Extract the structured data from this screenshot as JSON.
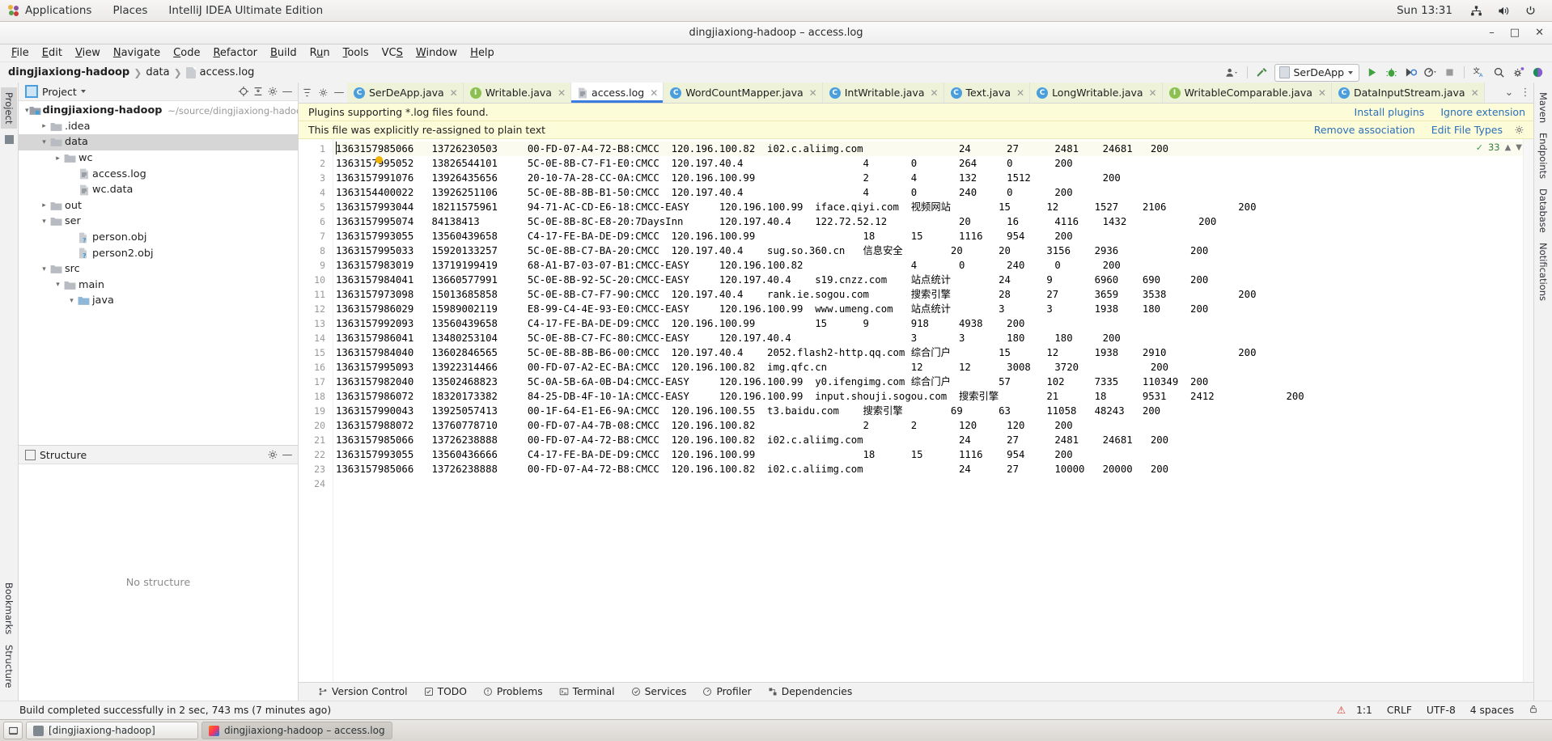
{
  "desktop": {
    "logo_icon": "gnome-logo-icon",
    "menus": [
      "Applications",
      "Places"
    ],
    "app_name": "IntelliJ IDEA Ultimate Edition",
    "clock": "Sun 13:31",
    "tray": [
      "network-icon",
      "volume-icon",
      "power-icon"
    ]
  },
  "window": {
    "title": "dingjiaxiong-hadoop – access.log",
    "minimize": "–",
    "maximize": "□",
    "close": "✕"
  },
  "menubar": [
    {
      "label": "File",
      "mnemonic": "F"
    },
    {
      "label": "Edit",
      "mnemonic": "E"
    },
    {
      "label": "View",
      "mnemonic": "V"
    },
    {
      "label": "Navigate",
      "mnemonic": "N"
    },
    {
      "label": "Code",
      "mnemonic": "C"
    },
    {
      "label": "Refactor",
      "mnemonic": "R"
    },
    {
      "label": "Build",
      "mnemonic": "B"
    },
    {
      "label": "Run",
      "mnemonic": "u"
    },
    {
      "label": "Tools",
      "mnemonic": "T"
    },
    {
      "label": "VCS",
      "mnemonic": "S"
    },
    {
      "label": "Window",
      "mnemonic": "W"
    },
    {
      "label": "Help",
      "mnemonic": "H"
    }
  ],
  "navbar": {
    "breadcrumbs": [
      "dingjiaxiong-hadoop",
      "data",
      "access.log"
    ],
    "run_config": "SerDeApp",
    "icons": [
      "user-dropdown-icon",
      "build-hammer-icon",
      "run-icon",
      "debug-icon",
      "run-coverage-icon",
      "profile-icon",
      "stop-icon",
      "translate-icon",
      "search-everywhere-icon",
      "settings-gear-icon",
      "ai-assistant-icon"
    ]
  },
  "left_strip": {
    "tabs": [
      "Project",
      "Bookmarks",
      "Structure"
    ],
    "active": "Project"
  },
  "right_strip": {
    "tabs": [
      "Maven",
      "Endpoints",
      "Database",
      "Notifications"
    ]
  },
  "project_panel": {
    "title": "Project",
    "icons": [
      "locate-icon",
      "collapse-all-icon",
      "settings-gear-icon",
      "hide-icon"
    ],
    "tree": [
      {
        "label": "dingjiaxiong-hadoop",
        "path": "~/source/dingjiaxiong-hadoop",
        "depth": 0,
        "twisty": "expanded",
        "icon": "project-module-icon",
        "bold": true,
        "selected": false
      },
      {
        "label": ".idea",
        "path": "",
        "depth": 1,
        "twisty": "collapsed",
        "icon": "folder-icon",
        "bold": false,
        "selected": false
      },
      {
        "label": "data",
        "path": "",
        "depth": 1,
        "twisty": "expanded",
        "icon": "folder-icon",
        "bold": false,
        "selected": true
      },
      {
        "label": "wc",
        "path": "",
        "depth": 2,
        "twisty": "collapsed",
        "icon": "folder-icon",
        "bold": false,
        "selected": false
      },
      {
        "label": "access.log",
        "path": "",
        "depth": 3,
        "twisty": "none",
        "icon": "text-file-icon",
        "bold": false,
        "selected": false
      },
      {
        "label": "wc.data",
        "path": "",
        "depth": 3,
        "twisty": "none",
        "icon": "text-file-icon",
        "bold": false,
        "selected": false
      },
      {
        "label": "out",
        "path": "",
        "depth": 1,
        "twisty": "collapsed",
        "icon": "folder-icon",
        "bold": false,
        "selected": false
      },
      {
        "label": "ser",
        "path": "",
        "depth": 1,
        "twisty": "expanded",
        "icon": "folder-icon",
        "bold": false,
        "selected": false
      },
      {
        "label": "person.obj",
        "path": "",
        "depth": 3,
        "twisty": "none",
        "icon": "unknown-file-icon",
        "bold": false,
        "selected": false
      },
      {
        "label": "person2.obj",
        "path": "",
        "depth": 3,
        "twisty": "none",
        "icon": "unknown-file-icon",
        "bold": false,
        "selected": false
      },
      {
        "label": "src",
        "path": "",
        "depth": 1,
        "twisty": "expanded",
        "icon": "folder-icon",
        "bold": false,
        "selected": false
      },
      {
        "label": "main",
        "path": "",
        "depth": 2,
        "twisty": "expanded",
        "icon": "folder-icon",
        "bold": false,
        "selected": false
      },
      {
        "label": "java",
        "path": "",
        "depth": 3,
        "twisty": "expanded",
        "icon": "source-folder-icon",
        "bold": false,
        "selected": false
      }
    ]
  },
  "structure_panel": {
    "title": "Structure",
    "empty_text": "No structure",
    "icons": [
      "settings-gear-icon",
      "hide-icon"
    ]
  },
  "editor_tabs": [
    {
      "label": "SerDeApp.java",
      "icon": "java-class-icon",
      "active": false,
      "closable": true
    },
    {
      "label": "Writable.java",
      "icon": "java-interface-icon",
      "active": false,
      "closable": true
    },
    {
      "label": "access.log",
      "icon": "text-file-icon",
      "active": true,
      "closable": true
    },
    {
      "label": "WordCountMapper.java",
      "icon": "java-class-icon",
      "active": false,
      "closable": true
    },
    {
      "label": "IntWritable.java",
      "icon": "java-class-icon",
      "active": false,
      "closable": true
    },
    {
      "label": "Text.java",
      "icon": "java-class-icon",
      "active": false,
      "closable": true
    },
    {
      "label": "LongWritable.java",
      "icon": "java-class-icon",
      "active": false,
      "closable": true
    },
    {
      "label": "WritableComparable.java",
      "icon": "java-interface-icon",
      "active": false,
      "closable": true
    },
    {
      "label": "DataInputStream.java",
      "icon": "java-class-icon",
      "active": false,
      "closable": true
    }
  ],
  "banners": [
    {
      "text": "Plugins supporting *.log files found.",
      "links": [
        "Install plugins",
        "Ignore extension"
      ],
      "gear": false
    },
    {
      "text": "This file was explicitly re-assigned to plain text",
      "links": [
        "Remove association",
        "Edit File Types"
      ],
      "gear": true
    }
  ],
  "editor": {
    "inspection_count": "33",
    "lines": [
      "1363157985066\t13726230503\t00-FD-07-A4-72-B8:CMCC\t120.196.100.82\ti02.c.aliimg.com\t\t24\t27\t2481\t24681\t200",
      "1363157995052\t13826544101\t5C-0E-8B-C7-F1-E0:CMCC\t120.197.40.4\t\t\t4\t0\t264\t0\t200",
      "1363157991076\t13926435656\t20-10-7A-28-CC-0A:CMCC\t120.196.100.99\t\t\t2\t4\t132\t1512\t\t200",
      "1363154400022\t13926251106\t5C-0E-8B-8B-B1-50:CMCC\t120.197.40.4\t\t\t4\t0\t240\t0\t200",
      "1363157993044\t18211575961\t94-71-AC-CD-E6-18:CMCC-EASY\t120.196.100.99\tiface.qiyi.com\t视频网站\t15\t12\t1527\t2106\t\t200",
      "1363157995074\t84138413\t5C-0E-8B-8C-E8-20:7DaysInn\t120.197.40.4\t122.72.52.12\t\t20\t16\t4116\t1432\t\t200",
      "1363157993055\t13560439658\tC4-17-FE-BA-DE-D9:CMCC\t120.196.100.99\t\t\t18\t15\t1116\t954\t200",
      "1363157995033\t15920133257\t5C-0E-8B-C7-BA-20:CMCC\t120.197.40.4\tsug.so.360.cn\t信息安全\t20\t20\t3156\t2936\t\t200",
      "1363157983019\t13719199419\t68-A1-B7-03-07-B1:CMCC-EASY\t120.196.100.82\t\t\t4\t0\t240\t0\t200",
      "1363157984041\t13660577991\t5C-0E-8B-92-5C-20:CMCC-EASY\t120.197.40.4\ts19.cnzz.com\t站点统计\t24\t9\t6960\t690\t200",
      "1363157973098\t15013685858\t5C-0E-8B-C7-F7-90:CMCC\t120.197.40.4\trank.ie.sogou.com\t搜索引擎\t28\t27\t3659\t3538\t\t200",
      "1363157986029\t15989002119\tE8-99-C4-4E-93-E0:CMCC-EASY\t120.196.100.99\twww.umeng.com\t站点统计\t3\t3\t1938\t180\t200",
      "1363157992093\t13560439658\tC4-17-FE-BA-DE-D9:CMCC\t120.196.100.99\t\t15\t9\t918\t4938\t200",
      "1363157986041\t13480253104\t5C-0E-8B-C7-FC-80:CMCC-EASY\t120.197.40.4\t\t\t3\t3\t180\t180\t200",
      "1363157984040\t13602846565\t5C-0E-8B-8B-B6-00:CMCC\t120.197.40.4\t2052.flash2-http.qq.com\t综合门户\t15\t12\t1938\t2910\t\t200",
      "1363157995093\t13922314466\t00-FD-07-A2-EC-BA:CMCC\t120.196.100.82\timg.qfc.cn\t\t12\t12\t3008\t3720\t\t200",
      "1363157982040\t13502468823\t5C-0A-5B-6A-0B-D4:CMCC-EASY\t120.196.100.99\ty0.ifengimg.com\t综合门户\t57\t102\t7335\t110349\t200",
      "1363157986072\t18320173382\t84-25-DB-4F-10-1A:CMCC-EASY\t120.196.100.99\tinput.shouji.sogou.com\t搜索引擎\t21\t18\t9531\t2412\t\t200",
      "1363157990043\t13925057413\t00-1F-64-E1-E6-9A:CMCC\t120.196.100.55\tt3.baidu.com\t搜索引擎\t69\t63\t11058\t48243\t200",
      "1363157988072\t13760778710\t00-FD-07-A4-7B-08:CMCC\t120.196.100.82\t\t\t2\t2\t120\t120\t200",
      "1363157985066\t13726238888\t00-FD-07-A4-72-B8:CMCC\t120.196.100.82\ti02.c.aliimg.com\t\t24\t27\t2481\t24681\t200",
      "1363157993055\t13560436666\tC4-17-FE-BA-DE-D9:CMCC\t120.196.100.99\t\t\t18\t15\t1116\t954\t200",
      "1363157985066\t13726238888\t00-FD-07-A4-72-B8:CMCC\t120.196.100.82\ti02.c.aliimg.com\t\t24\t27\t10000\t20000\t200",
      ""
    ]
  },
  "tool_window_bar": [
    {
      "label": "Version Control",
      "icon": "branch-icon"
    },
    {
      "label": "TODO",
      "icon": "todo-icon"
    },
    {
      "label": "Problems",
      "icon": "problems-icon"
    },
    {
      "label": "Terminal",
      "icon": "terminal-icon"
    },
    {
      "label": "Services",
      "icon": "services-icon"
    },
    {
      "label": "Profiler",
      "icon": "profiler-icon"
    },
    {
      "label": "Dependencies",
      "icon": "dependencies-icon"
    }
  ],
  "status_bar": {
    "message": "Build completed successfully in 2 sec, 743 ms (7 minutes ago)",
    "error_badge": "⚠",
    "caret_position": "1:1",
    "line_separator": "CRLF",
    "encoding": "UTF-8",
    "indent": "4 spaces",
    "lock_icon": "read-only-lock-icon"
  },
  "taskbar": {
    "items": [
      {
        "label": "[dingjiaxiong-hadoop]",
        "icon": "window-icon",
        "active": false
      },
      {
        "label": "dingjiaxiong-hadoop – access.log",
        "icon": "intellij-icon",
        "active": true
      }
    ],
    "show_desktop_icon": "show-desktop-icon"
  },
  "colors": {
    "accent": "#3b7ddd",
    "banner_bg": "#fdfcd9",
    "link": "#2a6fba",
    "selection": "#d6d6d6",
    "error": "#d9342b"
  }
}
